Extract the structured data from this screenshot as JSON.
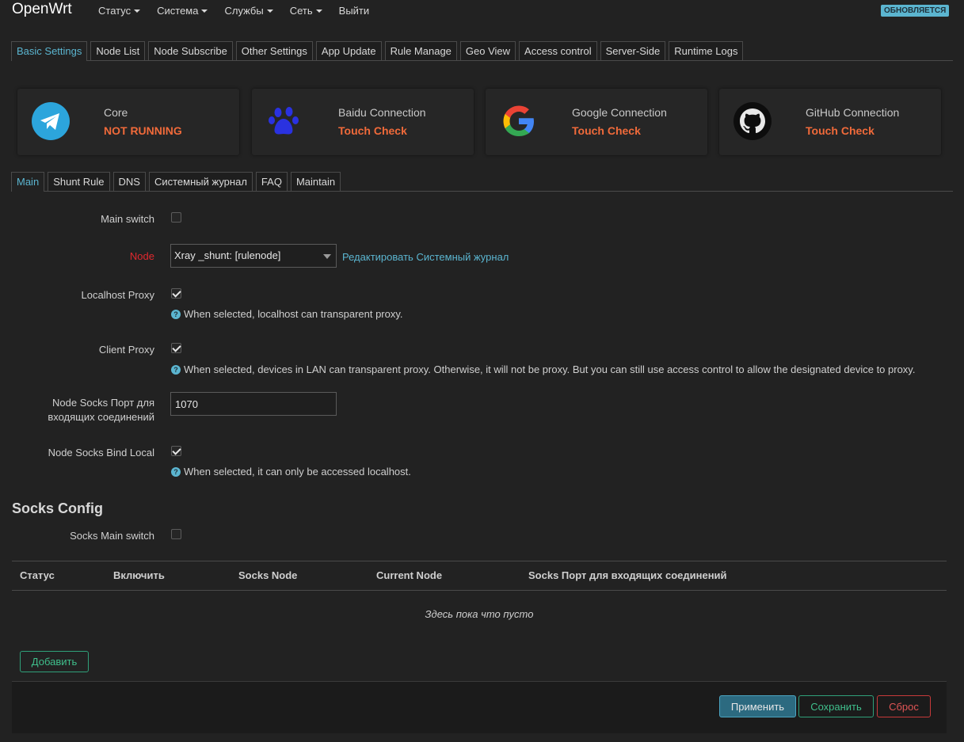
{
  "brand": "OpenWrt",
  "menu": [
    {
      "label": "Статус",
      "dropdown": true
    },
    {
      "label": "Система",
      "dropdown": true
    },
    {
      "label": "Службы",
      "dropdown": true
    },
    {
      "label": "Сеть",
      "dropdown": true
    },
    {
      "label": "Выйти",
      "dropdown": false
    }
  ],
  "update_badge": "ОБНОВЛЯЕТСЯ",
  "primary_tabs": [
    "Basic Settings",
    "Node List",
    "Node Subscribe",
    "Other Settings",
    "App Update",
    "Rule Manage",
    "Geo View",
    "Access control",
    "Server-Side",
    "Runtime Logs"
  ],
  "primary_active": "Basic Settings",
  "cards": [
    {
      "title": "Core",
      "status": "NOT RUNNING",
      "icon": "telegram-icon"
    },
    {
      "title": "Baidu Connection",
      "status": "Touch Check",
      "icon": "baidu-paw-icon"
    },
    {
      "title": "Google Connection",
      "status": "Touch Check",
      "icon": "google-icon"
    },
    {
      "title": "GitHub Connection",
      "status": "Touch Check",
      "icon": "github-icon"
    }
  ],
  "secondary_tabs": [
    "Main",
    "Shunt Rule",
    "DNS",
    "Системный журнал",
    "FAQ",
    "Maintain"
  ],
  "secondary_active": "Main",
  "form": {
    "main_switch": {
      "label": "Main switch",
      "checked": false
    },
    "node": {
      "label": "Node",
      "value": "Xray _shunt: [rulenode]",
      "link_edit": "Редактировать",
      "link_log": "Системный журнал"
    },
    "localhost_proxy": {
      "label": "Localhost Proxy",
      "checked": true,
      "hint": "When selected, localhost can transparent proxy."
    },
    "client_proxy": {
      "label": "Client Proxy",
      "checked": true,
      "hint": "When selected, devices in LAN can transparent proxy. Otherwise, it will not be proxy. But you can still use access control to allow the designated device to proxy."
    },
    "socks_port": {
      "label_line1": "Node Socks Порт для",
      "label_line2": "входящих соединений",
      "value": "1070"
    },
    "socks_bind_local": {
      "label": "Node Socks Bind Local",
      "checked": true,
      "hint": "When selected, it can only be accessed localhost."
    }
  },
  "socks_config": {
    "title": "Socks Config",
    "main_switch": {
      "label": "Socks Main switch",
      "checked": false
    },
    "columns": [
      "Статус",
      "Включить",
      "Socks Node",
      "Current Node",
      "Socks Порт для входящих соединений"
    ],
    "empty_text": "Здесь пока что пусто",
    "add_button": "Добавить"
  },
  "actions": {
    "apply": "Применить",
    "save": "Сохранить",
    "reset": "Сброс"
  }
}
